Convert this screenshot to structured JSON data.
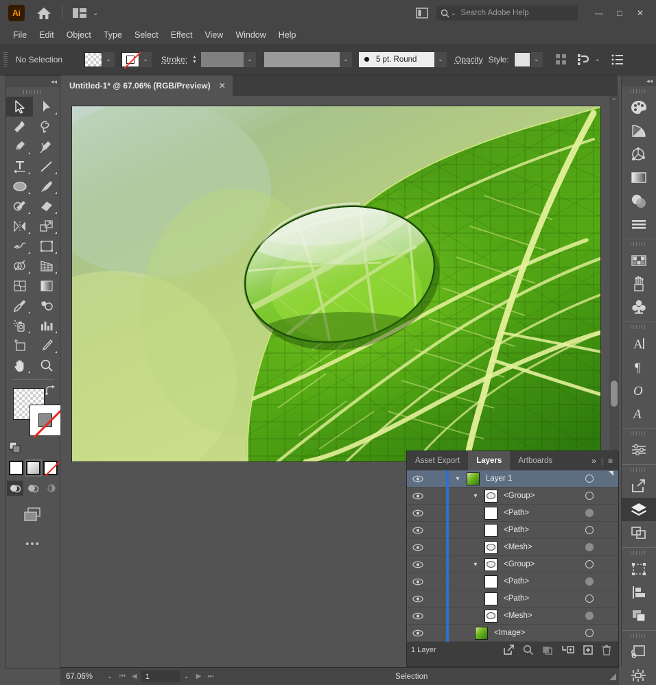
{
  "app": {
    "name": "Adobe Illustrator",
    "logo_text": "Ai",
    "accent_color": "#ff9a00",
    "chrome_color": "#454545",
    "panel_color": "#535353",
    "selection_blue": "#5d6e82",
    "layer_bar_blue": "#2f6fd0"
  },
  "titlebar": {
    "home_icon": "home-icon",
    "arrange_icon": "arrange-documents-icon",
    "arrange_chevron": "⌄",
    "panel_toggle_icon": "panel-toggle-icon",
    "search": {
      "icon": "search-icon",
      "chevron": "⌄",
      "placeholder": "Search Adobe Help",
      "value": ""
    },
    "window_buttons": {
      "minimize": "—",
      "maximize": "□",
      "close": "✕"
    }
  },
  "menubar": {
    "items": [
      {
        "label": "File"
      },
      {
        "label": "Edit"
      },
      {
        "label": "Object"
      },
      {
        "label": "Type"
      },
      {
        "label": "Select"
      },
      {
        "label": "Effect"
      },
      {
        "label": "View"
      },
      {
        "label": "Window"
      },
      {
        "label": "Help"
      }
    ]
  },
  "controlbar": {
    "selection_label": "No Selection",
    "fill_swatch": "none-checkerboard",
    "fill_dropdown_chevron": "⌄",
    "stroke_swatch": "none-red-slash",
    "stroke_dropdown_chevron": "⌄",
    "stroke_label": "Stroke:",
    "stroke_weight_value": "",
    "stroke_weight_chevron": "⌄",
    "stroke_profile_value": "",
    "stroke_profile_chevron": "⌄",
    "brush_definition": "5 pt. Round",
    "brush_chevron": "⌄",
    "opacity_label": "Opacity",
    "style_label": "Style:",
    "style_chevron": "⌄",
    "align_icon": "align-icon",
    "distribute_icon": "distribute-spacing-icon",
    "distribute_chevron": "⌄",
    "options_icon": "more-options-icon"
  },
  "document_tab": {
    "title": "Untitled-1* @ 67.06% (RGB/Preview)",
    "close_glyph": "✕"
  },
  "toolbar": {
    "collapse_glyph": "◂◂",
    "tools": [
      {
        "name": "selection-tool",
        "selected": true,
        "flyout": false
      },
      {
        "name": "direct-selection-tool",
        "selected": false,
        "flyout": true
      },
      {
        "name": "magic-wand-tool",
        "selected": false,
        "flyout": false
      },
      {
        "name": "lasso-tool",
        "selected": false,
        "flyout": false
      },
      {
        "name": "pen-tool",
        "selected": false,
        "flyout": true
      },
      {
        "name": "curvature-tool",
        "selected": false,
        "flyout": false
      },
      {
        "name": "type-tool",
        "selected": false,
        "flyout": true
      },
      {
        "name": "line-segment-tool",
        "selected": false,
        "flyout": true
      },
      {
        "name": "ellipse-tool",
        "selected": false,
        "flyout": true
      },
      {
        "name": "paintbrush-tool",
        "selected": false,
        "flyout": true
      },
      {
        "name": "shaper-tool",
        "selected": false,
        "flyout": true
      },
      {
        "name": "eraser-tool",
        "selected": false,
        "flyout": true
      },
      {
        "name": "rotate-tool",
        "selected": false,
        "flyout": true
      },
      {
        "name": "scale-tool",
        "selected": false,
        "flyout": true
      },
      {
        "name": "width-tool",
        "selected": false,
        "flyout": true
      },
      {
        "name": "free-transform-tool",
        "selected": false,
        "flyout": true
      },
      {
        "name": "shape-builder-tool",
        "selected": false,
        "flyout": true
      },
      {
        "name": "perspective-grid-tool",
        "selected": false,
        "flyout": true
      },
      {
        "name": "mesh-tool",
        "selected": false,
        "flyout": false
      },
      {
        "name": "gradient-tool",
        "selected": false,
        "flyout": false
      },
      {
        "name": "eyedropper-tool",
        "selected": false,
        "flyout": true
      },
      {
        "name": "blend-tool",
        "selected": false,
        "flyout": false
      },
      {
        "name": "symbol-sprayer-tool",
        "selected": false,
        "flyout": true
      },
      {
        "name": "column-graph-tool",
        "selected": false,
        "flyout": true
      },
      {
        "name": "artboard-tool",
        "selected": false,
        "flyout": false
      },
      {
        "name": "slice-tool",
        "selected": false,
        "flyout": true
      },
      {
        "name": "hand-tool",
        "selected": false,
        "flyout": true
      },
      {
        "name": "zoom-tool",
        "selected": false,
        "flyout": false
      }
    ],
    "fill_swatch": "transparent-checkerboard",
    "stroke_swatch": "none-red-slash",
    "swap_icon": "swap-fill-stroke-icon",
    "default_icon": "default-fill-stroke-icon",
    "color_modes": [
      {
        "name": "color-mode-button",
        "type": "solid",
        "active": false
      },
      {
        "name": "gradient-mode-button",
        "type": "gradient",
        "active": true
      },
      {
        "name": "none-mode-button",
        "type": "none",
        "active": false
      }
    ],
    "draw_modes": [
      {
        "name": "draw-normal-button",
        "active": true
      },
      {
        "name": "draw-behind-button",
        "active": false
      },
      {
        "name": "draw-inside-button",
        "active": false
      }
    ],
    "screen_mode_icon": "change-screen-mode-icon",
    "more_tools_glyph": "•••"
  },
  "canvas": {
    "artwork_description": "macro photograph of a water droplet on a green leaf",
    "scroll_up_glyph": "⌃"
  },
  "rightdock": {
    "collapse_glyph": "◂◂",
    "groups": [
      {
        "items": [
          {
            "name": "color-panel-icon",
            "active": false
          },
          {
            "name": "color-guide-panel-icon",
            "active": false
          },
          {
            "name": "color-themes-panel-icon",
            "active": false
          },
          {
            "name": "gradient-panel-icon",
            "active": false
          },
          {
            "name": "transparency-panel-icon",
            "active": false
          },
          {
            "name": "stroke-panel-icon",
            "active": false
          }
        ]
      },
      {
        "items": [
          {
            "name": "swatches-panel-icon",
            "active": false
          },
          {
            "name": "brushes-panel-icon",
            "active": false
          },
          {
            "name": "symbols-panel-icon",
            "active": false
          }
        ]
      },
      {
        "items": [
          {
            "name": "character-panel-icon",
            "active": false
          },
          {
            "name": "paragraph-panel-icon",
            "active": false
          },
          {
            "name": "opentype-panel-icon",
            "active": false
          },
          {
            "name": "glyphs-panel-icon",
            "active": false
          }
        ]
      },
      {
        "items": [
          {
            "name": "properties-panel-icon",
            "active": false
          }
        ]
      },
      {
        "items": [
          {
            "name": "asset-export-panel-icon",
            "active": false
          },
          {
            "name": "layers-panel-icon",
            "active": true
          },
          {
            "name": "artboards-panel-icon",
            "active": false
          }
        ]
      },
      {
        "items": [
          {
            "name": "transform-panel-icon",
            "active": false
          },
          {
            "name": "align-panel-icon",
            "active": false
          },
          {
            "name": "pathfinder-panel-icon",
            "active": false
          }
        ]
      },
      {
        "items": [
          {
            "name": "image-trace-panel-icon",
            "active": false
          },
          {
            "name": "separations-preview-panel-icon",
            "active": false
          }
        ]
      }
    ]
  },
  "layers_panel": {
    "tabs": [
      {
        "label": "Asset Export",
        "active": false
      },
      {
        "label": "Layers",
        "active": true
      },
      {
        "label": "Artboards",
        "active": false
      }
    ],
    "overflow_glyph": "»",
    "menu_glyph": "≡",
    "rows": [
      {
        "name": "Layer 1",
        "indent": 0,
        "thumb": "image",
        "disclosure": true,
        "expanded": true,
        "selected": true,
        "target_filled": false,
        "visible": true
      },
      {
        "name": "<Group>",
        "indent": 1,
        "thumb": "mesh",
        "disclosure": true,
        "expanded": true,
        "selected": false,
        "target_filled": false,
        "visible": true
      },
      {
        "name": "<Path>",
        "indent": 2,
        "thumb": "blank",
        "disclosure": false,
        "expanded": false,
        "selected": false,
        "target_filled": true,
        "visible": true
      },
      {
        "name": "<Path>",
        "indent": 2,
        "thumb": "blank",
        "disclosure": false,
        "expanded": false,
        "selected": false,
        "target_filled": false,
        "visible": true
      },
      {
        "name": "<Mesh>",
        "indent": 2,
        "thumb": "mesh",
        "disclosure": false,
        "expanded": false,
        "selected": false,
        "target_filled": true,
        "visible": true
      },
      {
        "name": "<Group>",
        "indent": 1,
        "thumb": "mesh",
        "disclosure": true,
        "expanded": true,
        "selected": false,
        "target_filled": false,
        "visible": true
      },
      {
        "name": "<Path>",
        "indent": 2,
        "thumb": "blank",
        "disclosure": false,
        "expanded": false,
        "selected": false,
        "target_filled": true,
        "visible": true
      },
      {
        "name": "<Path>",
        "indent": 2,
        "thumb": "blank",
        "disclosure": false,
        "expanded": false,
        "selected": false,
        "target_filled": false,
        "visible": true
      },
      {
        "name": "<Mesh>",
        "indent": 2,
        "thumb": "mesh",
        "disclosure": false,
        "expanded": false,
        "selected": false,
        "target_filled": true,
        "visible": true
      },
      {
        "name": "<Image>",
        "indent": 2,
        "thumb": "image",
        "disclosure": false,
        "expanded": false,
        "selected": false,
        "target_filled": false,
        "visible": true
      }
    ],
    "footer": {
      "count_label": "1 Layer",
      "buttons": [
        {
          "name": "locate-object-button"
        },
        {
          "name": "search-layers-button"
        },
        {
          "name": "make-clipping-mask-button"
        },
        {
          "name": "create-new-sublayer-button"
        },
        {
          "name": "create-new-layer-button"
        },
        {
          "name": "delete-selection-button"
        }
      ]
    }
  },
  "statusbar": {
    "zoom_value": "67.06%",
    "zoom_chevron": "⌄",
    "first_page_glyph": "⏮",
    "prev_page_glyph": "◀",
    "page_value": "1",
    "page_chevron": "⌄",
    "next_page_glyph": "▶",
    "last_page_glyph": "⏭",
    "status_text": "Selection"
  }
}
